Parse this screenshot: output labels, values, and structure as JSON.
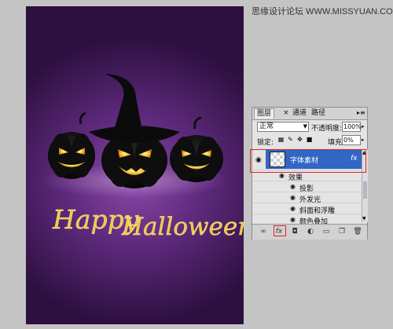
{
  "watermark": "思缘设计论坛 WWW.MISSYUAN.COM",
  "artwork": {
    "greeting_word1": "Happy",
    "greeting_word2": "Halloween",
    "bg_color_dark": "#2e1040",
    "bg_color_mid": "#8a49a8",
    "text_color": "#f2c840"
  },
  "layers_panel": {
    "tabs": [
      {
        "label": "图层",
        "active": true
      },
      {
        "label": "通道",
        "active": false
      },
      {
        "label": "路径",
        "active": false
      }
    ],
    "close_icon": "close-icon",
    "blend_mode": "正常",
    "opacity_label": "不透明度:",
    "opacity_value": "100%",
    "lock_label": "锁定:",
    "fill_label": "填充:",
    "fill_value": "0%",
    "layer": {
      "name": "字体素材",
      "fx_badge": "fx",
      "selected_color": "#3165c6"
    },
    "effects_header": "效果",
    "effects": [
      "投影",
      "外发光",
      "斜面和浮雕",
      "颜色叠加"
    ],
    "bottom_icons": [
      "link-icon",
      "fx-icon",
      "mask-icon",
      "adjustment-icon",
      "group-icon",
      "new-layer-icon",
      "trash-icon"
    ]
  }
}
